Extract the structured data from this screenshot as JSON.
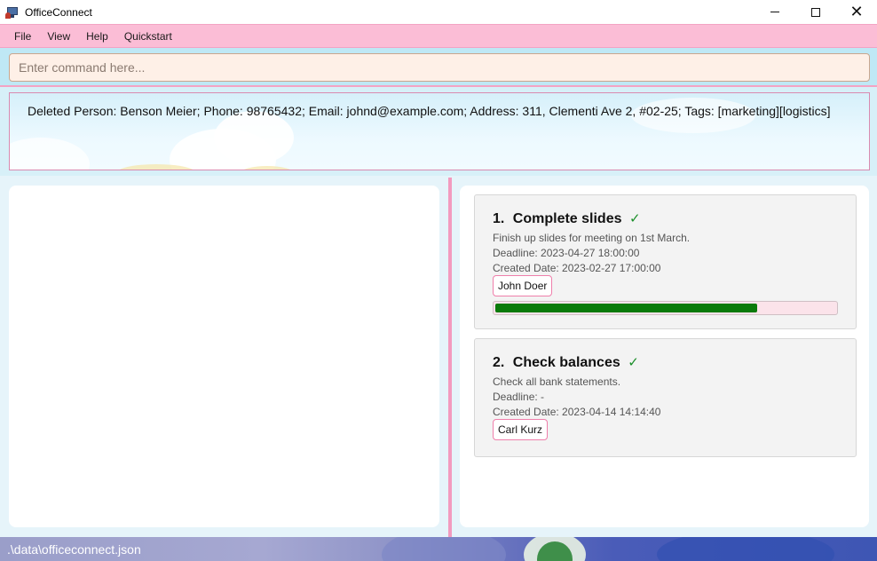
{
  "window": {
    "title": "OfficeConnect",
    "icon": "office-connect-app-icon",
    "controls": {
      "minimize": "minimize-icon",
      "maximize": "maximize-icon",
      "close": "close-icon"
    }
  },
  "menu": {
    "items": [
      {
        "label": "File"
      },
      {
        "label": "View"
      },
      {
        "label": "Help"
      },
      {
        "label": "Quickstart"
      }
    ]
  },
  "command": {
    "placeholder": "Enter command here...",
    "value": ""
  },
  "result": {
    "text": "Deleted Person: Benson Meier; Phone: 98765432; Email: johnd@example.com; Address: 311, Clementi Ave 2, #02-25; Tags: [marketing][logistics]"
  },
  "tasks": [
    {
      "index": "1.",
      "title": "Complete slides",
      "done_mark": "✓",
      "description": "Finish up slides for meeting on 1st March.",
      "deadline": "Deadline: 2023-04-27 18:00:00",
      "created": "Created Date: 2023-02-27 17:00:00",
      "assignee": "John Doer",
      "progress_fraction": 0.77
    },
    {
      "index": "2.",
      "title": "Check balances",
      "done_mark": "✓",
      "description": "Check all bank statements.",
      "deadline": "Deadline: -",
      "created": "Created Date: 2023-04-14 14:14:40",
      "assignee": "Carl Kurz"
    }
  ],
  "status": {
    "path": ".\\data\\officeconnect.json"
  },
  "colors": {
    "menu_bar": "#fbbdd6",
    "divider": "#f39bbf",
    "progress": "#0a7a0a",
    "check": "#1b8f2a"
  }
}
